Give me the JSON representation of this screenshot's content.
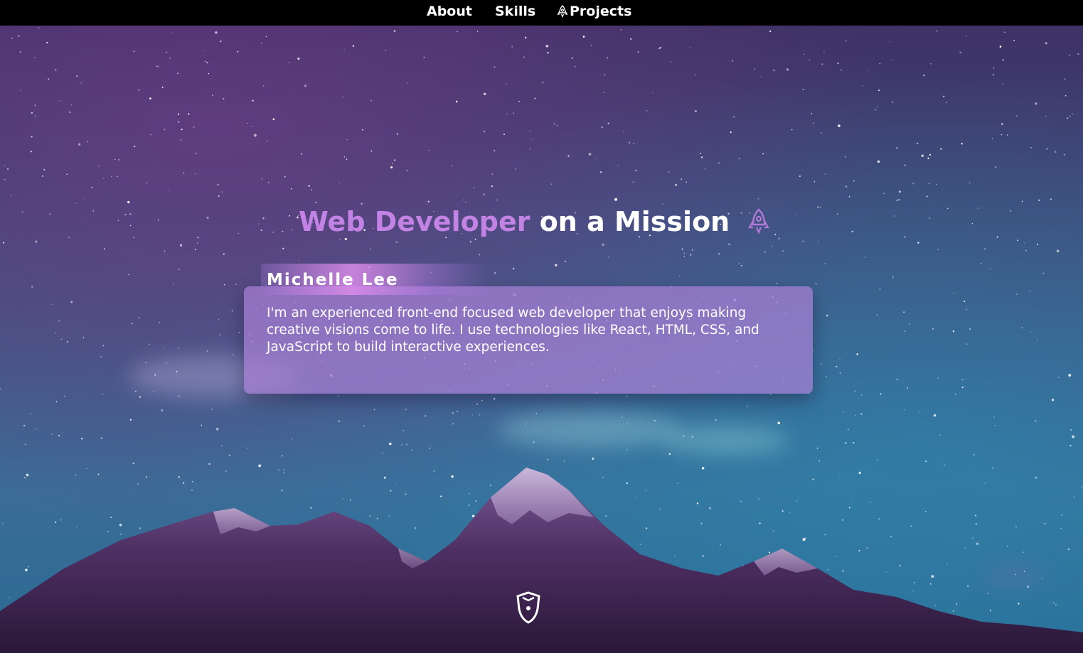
{
  "nav": {
    "items": [
      {
        "label": "About"
      },
      {
        "label": "Skills"
      },
      {
        "label": "Projects",
        "icon": "rocket-icon"
      }
    ]
  },
  "hero": {
    "title_accent": "Web Developer",
    "title_rest": "on a Mission",
    "title_icon": "rocket-icon",
    "name": "Michelle Lee",
    "bio": "I'm an experienced front-end focused web developer that enjoys making creative visions come to life. I use technologies like React, HTML, CSS, and JavaScript to build interactive experiences."
  },
  "scroll_button": {
    "icon": "scroll-down-shield-icon"
  },
  "colors": {
    "accent": "#c283e4",
    "nav_bg": "#000000",
    "card_bg": "#a880d6",
    "text": "#ffffff"
  }
}
